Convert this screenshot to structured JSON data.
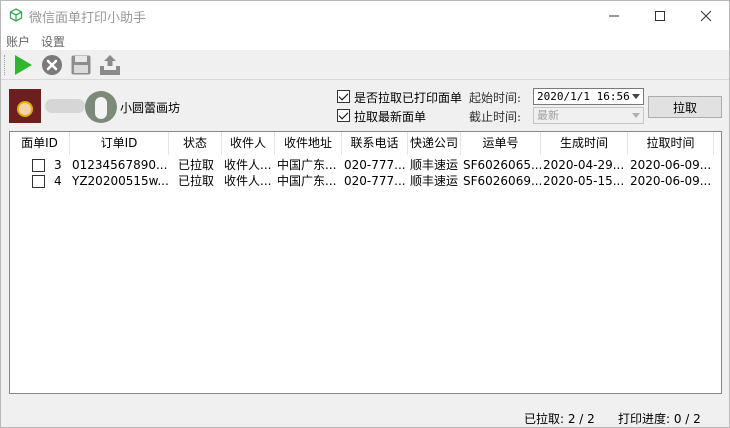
{
  "window": {
    "title": "微信面单打印小助手"
  },
  "menu": {
    "items": [
      "账户",
      "设置"
    ]
  },
  "toolbar": {
    "icons": [
      "play-icon",
      "stop-icon",
      "save-icon",
      "upload-icon"
    ]
  },
  "shop": {
    "name": "小圆蕾画坊"
  },
  "options": {
    "include_printed": {
      "label": "是否拉取已打印面单",
      "checked": true
    },
    "latest_only": {
      "label": "拉取最新面单",
      "checked": true
    },
    "start_time_label": "起始时间:",
    "start_time_value": "2020/1/1 16:56",
    "end_time_label": "截止时间:",
    "end_time_value": "最新",
    "pull_button": "拉取"
  },
  "table": {
    "columns": [
      "面单ID",
      "订单ID",
      "状态",
      "收件人",
      "收件地址",
      "联系电话",
      "快递公司",
      "运单号",
      "生成时间",
      "拉取时间"
    ],
    "rows": [
      {
        "checked": false,
        "id": "3",
        "order": "01234567890...",
        "status": "已拉取",
        "recipient": "收件人...",
        "address": "中国广东...",
        "phone": "020-777...",
        "carrier": "顺丰速运",
        "waybill": "SF6026065...",
        "created": "2020-04-29...",
        "pulled": "2020-06-09..."
      },
      {
        "checked": false,
        "id": "4",
        "order": "YZ20200515w...",
        "status": "已拉取",
        "recipient": "收件人...",
        "address": "中国广东...",
        "phone": "020-777...",
        "carrier": "顺丰速运",
        "waybill": "SF6026069...",
        "created": "2020-05-15...",
        "pulled": "2020-06-09..."
      }
    ]
  },
  "status": {
    "pulled": "已拉取: 2 / 2",
    "progress": "打印进度: 0 / 2"
  },
  "colors": {
    "play": "#2fb82f",
    "stop": "#7a7a7a"
  }
}
